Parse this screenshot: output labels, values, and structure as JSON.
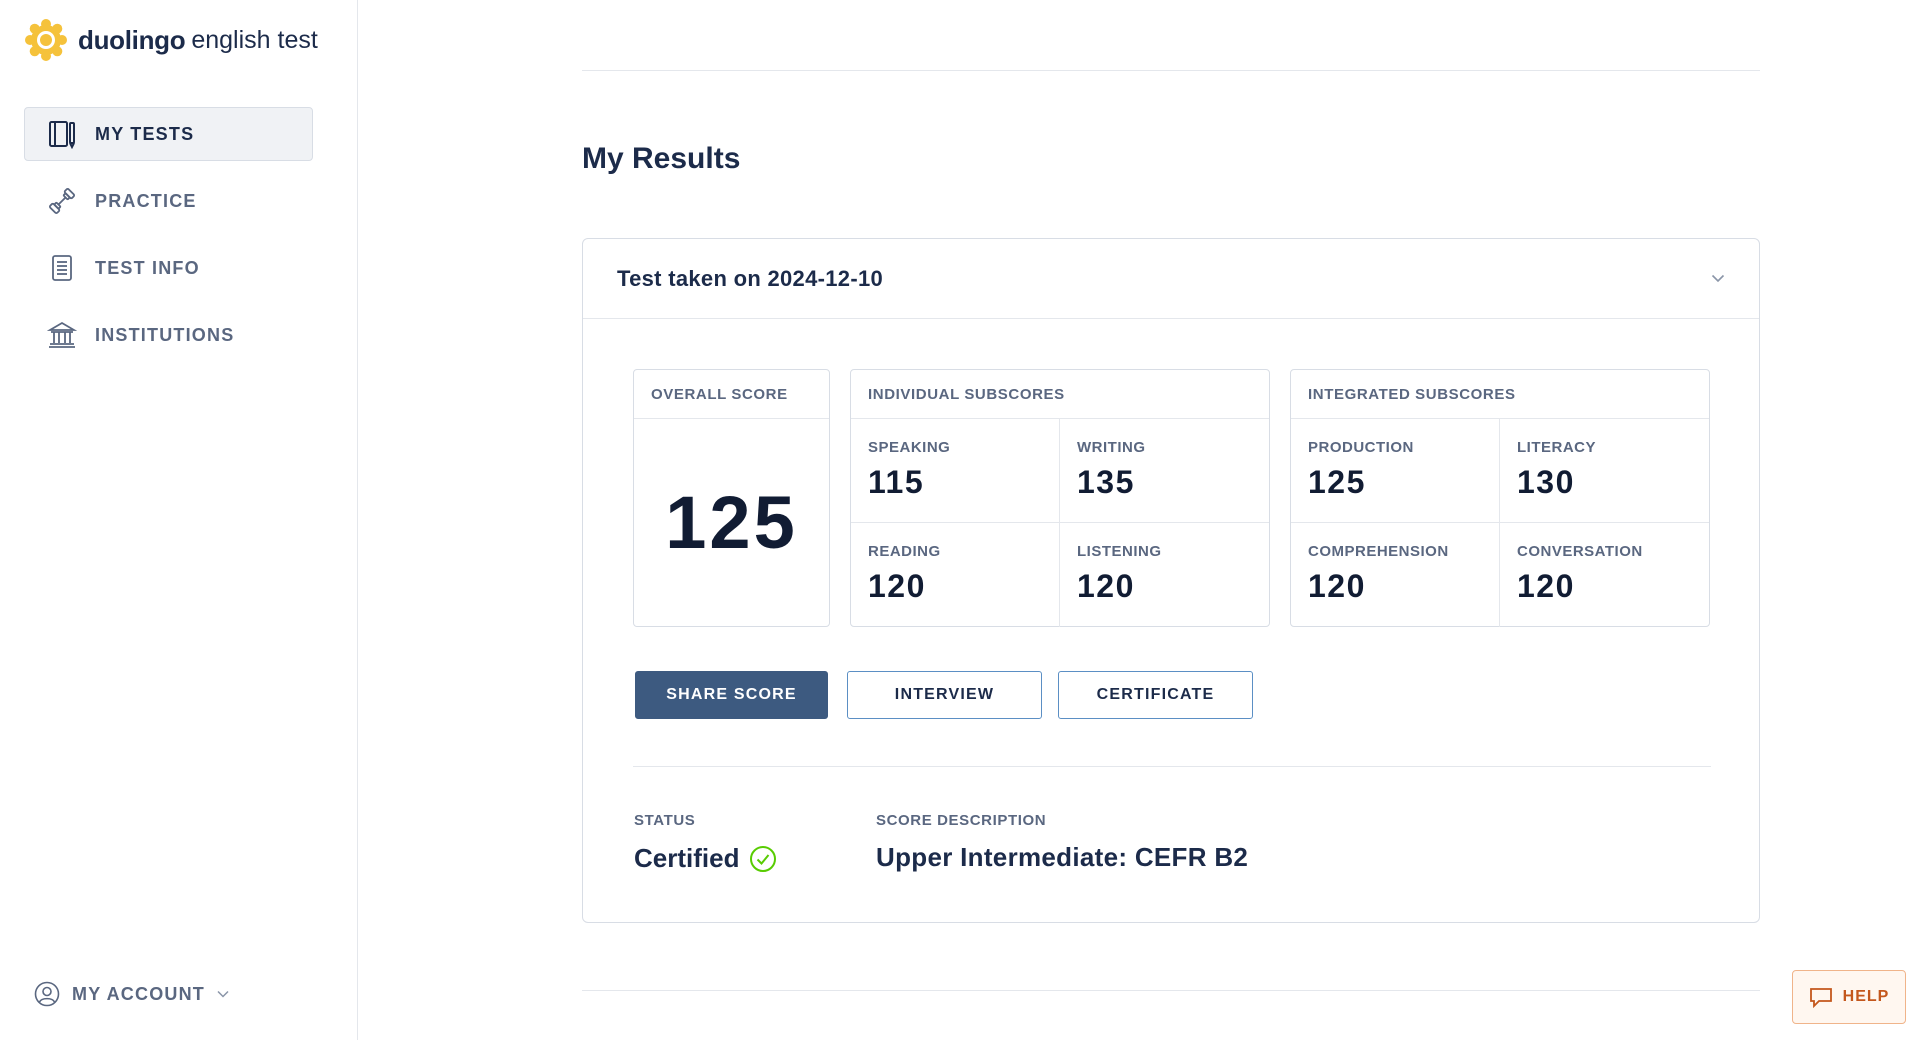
{
  "brand": {
    "name": "duolingo",
    "product": "english test",
    "logo_color": "#f5c23b"
  },
  "sidebar": {
    "items": [
      {
        "label": "MY TESTS",
        "icon": "book-icon",
        "active": true
      },
      {
        "label": "PRACTICE",
        "icon": "dumbbell-icon",
        "active": false
      },
      {
        "label": "TEST INFO",
        "icon": "document-icon",
        "active": false
      },
      {
        "label": "INSTITUTIONS",
        "icon": "institution-icon",
        "active": false
      }
    ],
    "account_label": "MY ACCOUNT"
  },
  "main": {
    "title": "My Results",
    "result": {
      "header": "Test taken on 2024-12-10",
      "overall": {
        "label": "OVERALL SCORE",
        "value": "125"
      },
      "individual": {
        "label": "INDIVIDUAL SUBSCORES",
        "items": [
          {
            "label": "SPEAKING",
            "value": "115"
          },
          {
            "label": "WRITING",
            "value": "135"
          },
          {
            "label": "READING",
            "value": "120"
          },
          {
            "label": "LISTENING",
            "value": "120"
          }
        ]
      },
      "integrated": {
        "label": "INTEGRATED SUBSCORES",
        "items": [
          {
            "label": "PRODUCTION",
            "value": "125"
          },
          {
            "label": "LITERACY",
            "value": "130"
          },
          {
            "label": "COMPREHENSION",
            "value": "120"
          },
          {
            "label": "CONVERSATION",
            "value": "120"
          }
        ]
      },
      "buttons": {
        "share": "SHARE SCORE",
        "interview": "INTERVIEW",
        "certificate": "CERTIFICATE"
      },
      "status": {
        "label": "STATUS",
        "value": "Certified"
      },
      "score_description": {
        "label": "SCORE DESCRIPTION",
        "value": "Upper Intermediate: CEFR B2"
      }
    }
  },
  "help": {
    "label": "HELP"
  },
  "colors": {
    "primary": "#3d5a80",
    "text": "#1c2b4a",
    "muted": "#5a6780",
    "success": "#58cc02",
    "help_accent": "#c4571c"
  }
}
